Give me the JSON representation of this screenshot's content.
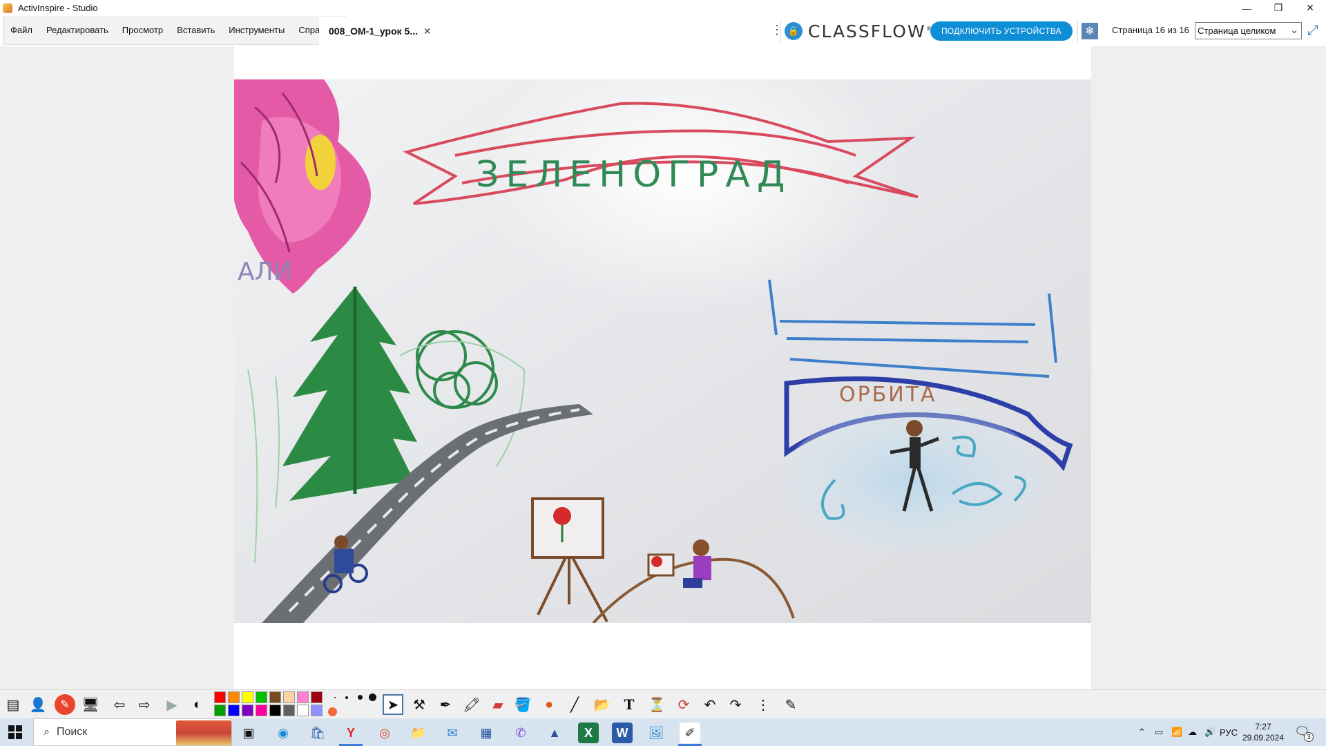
{
  "window": {
    "title": "ActivInspire - Studio",
    "minimize_glyph": "—",
    "restore_glyph": "❐",
    "close_glyph": "✕"
  },
  "menu": {
    "items": [
      "Файл",
      "Редактировать",
      "Просмотр",
      "Вставить",
      "Инструменты",
      "Справка"
    ]
  },
  "document_tab": {
    "label": "008_ОМ-1_урок 5...",
    "close_glyph": "✕"
  },
  "classflow": {
    "logo_text": "CLASSFLOW",
    "trademark": "®",
    "connect_button": "ПОДКЛЮЧИТЬ УСТРОЙСТВА"
  },
  "page_nav": {
    "info": "Страница 16 из 16",
    "zoom_value": "Страница целиком"
  },
  "drawing": {
    "banner_text": "ЗЕЛЕНОГРАД",
    "sign_text": "ОРБИТА",
    "corner_text": "АЛИ"
  },
  "toolbox": {
    "colors_top": [
      "#ff0000",
      "#ff8800",
      "#ffff00",
      "#00c000",
      "#7a4b1e",
      "#ffd0a0",
      "#ff7fd0",
      "#a00010"
    ],
    "colors_bottom": [
      "#00a000",
      "#0000ff",
      "#8000c0",
      "#ff00a0",
      "#000000",
      "#606060",
      "#ffffff",
      "#9090ff"
    ]
  },
  "taskbar": {
    "search_placeholder": "Поиск",
    "language": "РУС",
    "time": "7:27",
    "date": "29.09.2024",
    "notification_count": "3"
  },
  "colors": {
    "accent": "#0e8ed6",
    "taskbar": "#d7e4f0"
  }
}
